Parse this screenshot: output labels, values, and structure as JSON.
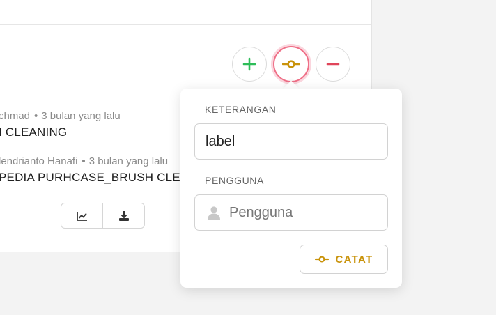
{
  "colors": {
    "add": "#2ebd59",
    "mark": "#c9930b",
    "remove": "#e0455a",
    "focus_ring": "#ef6f87"
  },
  "actions": {
    "add_icon": "plus-icon",
    "mark_icon": "commit-icon",
    "remove_icon": "minus-icon"
  },
  "history": [
    {
      "author": "chmad",
      "time": "3 bulan yang lalu",
      "title": "I CLEANING"
    },
    {
      "author": "lendrianto Hanafi",
      "time": "3 bulan yang lalu",
      "title": "PEDIA PURHCASE_BRUSH CLEA"
    }
  ],
  "toolbar": {
    "chart_icon": "chart-line-icon",
    "download_icon": "download-icon"
  },
  "popover": {
    "keterangan_label": "KETERANGAN",
    "keterangan_value": "label",
    "pengguna_label": "PENGGUNA",
    "pengguna_placeholder": "Pengguna",
    "submit_label": "CATAT"
  }
}
